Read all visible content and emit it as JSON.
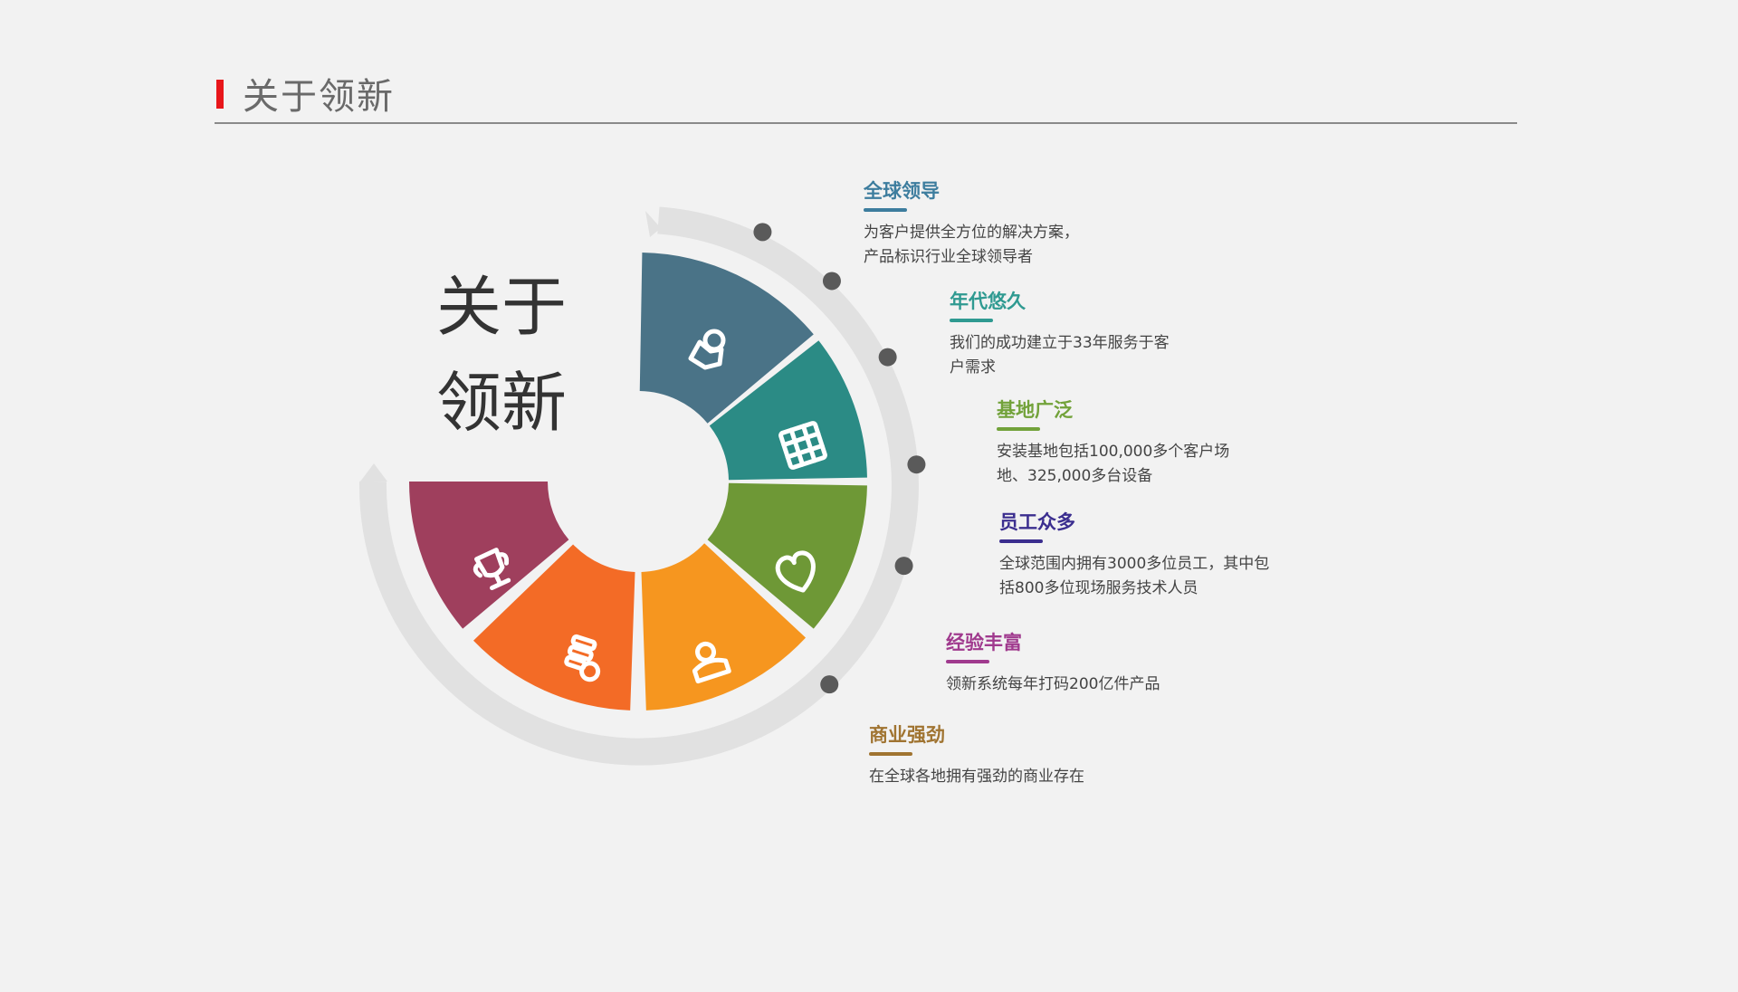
{
  "header": {
    "title": "关于领新",
    "accent": "#e8161a"
  },
  "hero": {
    "line1": "关于",
    "line2": "领新"
  },
  "segments": [
    {
      "color": "#4a7387",
      "icon": "person-pin-icon"
    },
    {
      "color": "#2b8b85",
      "icon": "grid-icon"
    },
    {
      "color": "#6e9836",
      "icon": "heart-icon"
    },
    {
      "color": "#f6961f",
      "icon": "user-badge-icon"
    },
    {
      "color": "#f36b26",
      "icon": "coin-stack-icon"
    },
    {
      "color": "#9f3f5d",
      "icon": "trophy-icon"
    }
  ],
  "items": [
    {
      "title": "全球领导",
      "color": "#3d7d9e",
      "lines": [
        "为客户提供全方位的解决方案，",
        "产品标识行业全球领导者"
      ]
    },
    {
      "title": "年代悠久",
      "color": "#2f9a91",
      "lines": [
        "我们的成功建立于33年服务于客",
        "户需求"
      ]
    },
    {
      "title": "基地广泛",
      "color": "#72a23a",
      "lines": [
        "安装基地包括100,000多个客户场",
        "地、325,000多台设备"
      ]
    },
    {
      "title": "员工众多",
      "color": "#3b2e8f",
      "lines": [
        "全球范围内拥有3000多位员工，其中包",
        "括800多位现场服务技术人员"
      ]
    },
    {
      "title": "经验丰富",
      "color": "#a03a8e",
      "lines": [
        "领新系统每年打码200亿件产品"
      ]
    },
    {
      "title": "商业强劲",
      "color": "#a07431",
      "lines": [
        "在全球各地拥有强劲的商业存在"
      ]
    }
  ]
}
